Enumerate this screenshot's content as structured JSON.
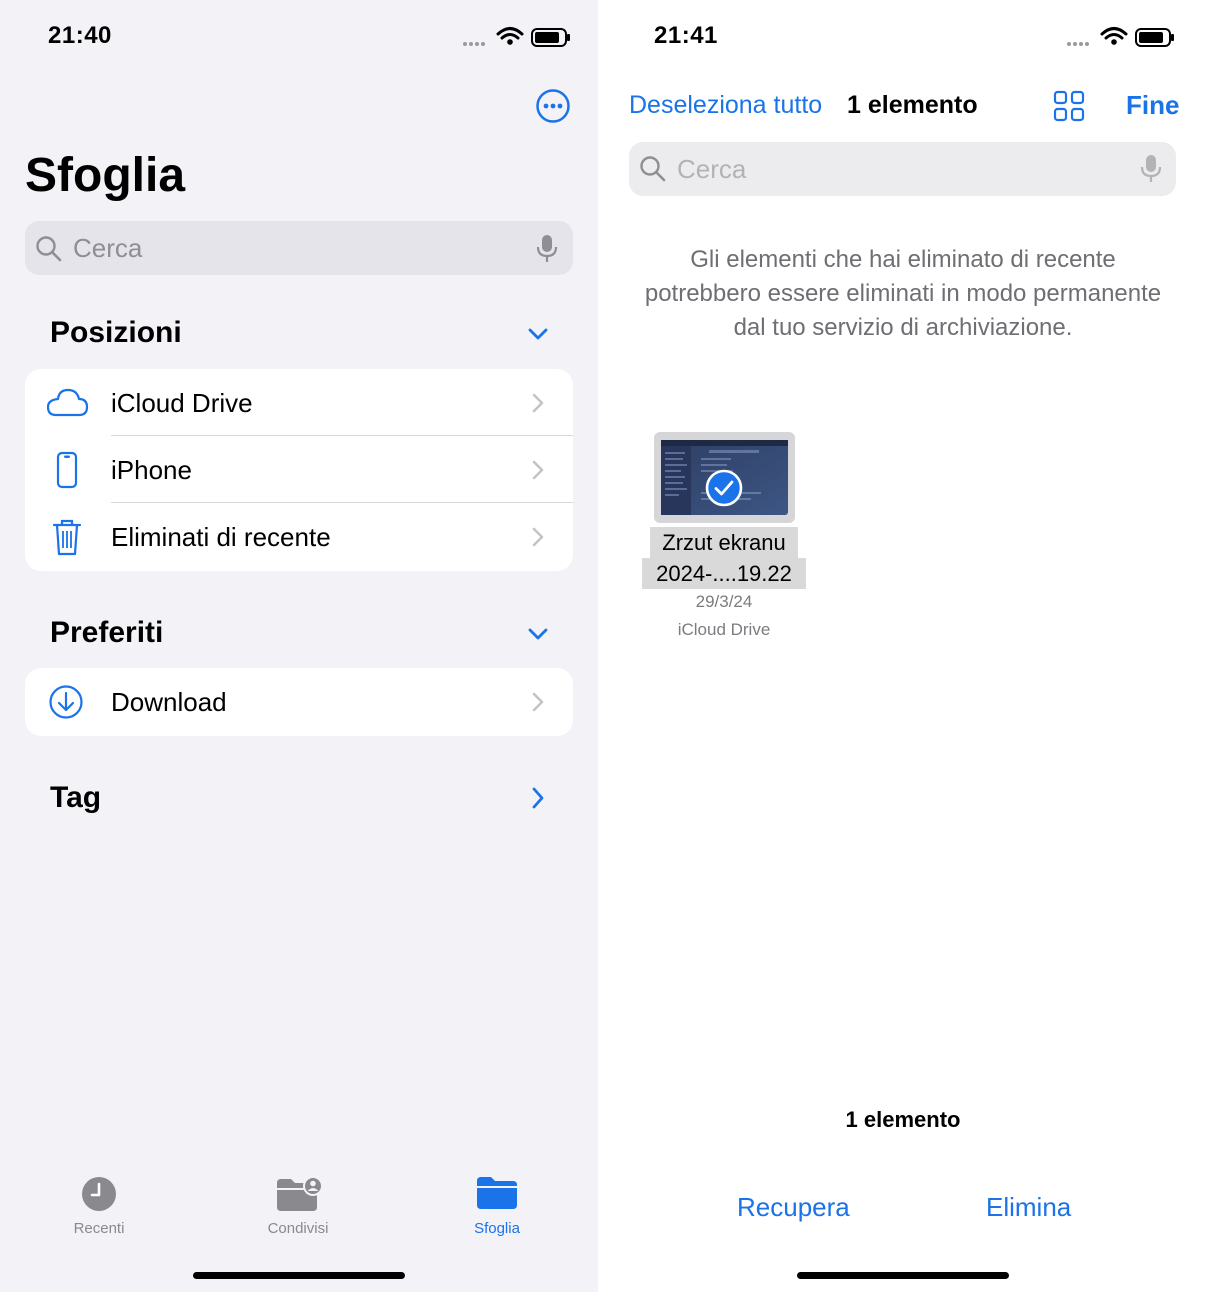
{
  "left": {
    "status": {
      "time": "21:40"
    },
    "title": "Sfoglia",
    "more_icon": "ellipsis-circle-icon",
    "search": {
      "placeholder": "Cerca"
    },
    "locations": {
      "title": "Posizioni",
      "items": [
        {
          "label": "iCloud Drive",
          "icon": "cloud-icon"
        },
        {
          "label": "iPhone",
          "icon": "iphone-icon"
        },
        {
          "label": "Eliminati di recente",
          "icon": "trash-icon"
        }
      ]
    },
    "favorites": {
      "title": "Preferiti",
      "items": [
        {
          "label": "Download",
          "icon": "download-circle-icon"
        }
      ]
    },
    "tags": {
      "title": "Tag"
    },
    "tabbar": [
      {
        "label": "Recenti",
        "icon": "clock-icon",
        "active": false
      },
      {
        "label": "Condivisi",
        "icon": "shared-folder-icon",
        "active": false
      },
      {
        "label": "Sfoglia",
        "icon": "folder-icon",
        "active": true
      }
    ]
  },
  "right": {
    "status": {
      "time": "21:41"
    },
    "nav": {
      "deselect_all": "Deseleziona tutto",
      "selection_count": "1 elemento",
      "done": "Fine"
    },
    "search": {
      "placeholder": "Cerca"
    },
    "description": "Gli elementi che hai eliminato di recente potrebbero essere eliminati in modo permanente dal tuo servizio di archiviazione.",
    "file": {
      "name_line1": "Zrzut ekranu",
      "name_line2": "2024-....19.22",
      "date": "29/3/24",
      "location": "iCloud Drive",
      "selected": true
    },
    "footer": {
      "count": "1 elemento",
      "recover": "Recupera",
      "delete": "Elimina"
    }
  },
  "colors": {
    "accent": "#1a73e8",
    "background_grouped": "#f2f2f7",
    "secondary_text": "#8e8e93"
  }
}
